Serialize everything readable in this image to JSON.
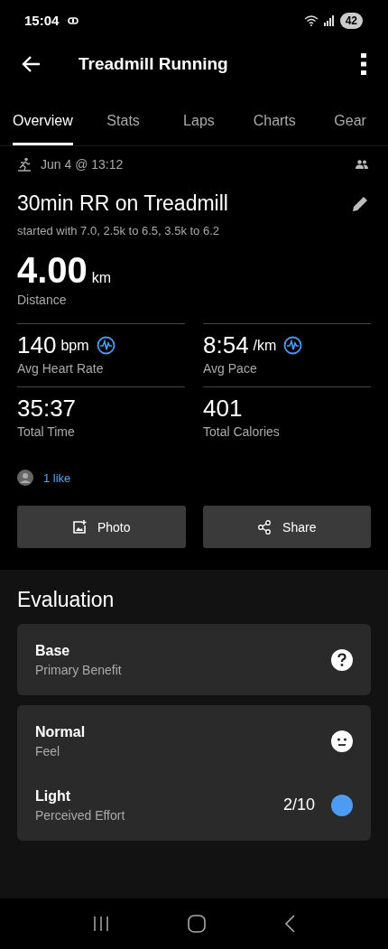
{
  "status_bar": {
    "time": "15:04",
    "battery": "42"
  },
  "app_bar": {
    "title": "Treadmill Running"
  },
  "tabs": [
    {
      "label": "Overview",
      "selected": true
    },
    {
      "label": "Stats",
      "selected": false
    },
    {
      "label": "Laps",
      "selected": false
    },
    {
      "label": "Charts",
      "selected": false
    },
    {
      "label": "Gear",
      "selected": false
    }
  ],
  "activity": {
    "date": "Jun 4 @ 13:12",
    "name": "30min RR on Treadmill",
    "description": "started with 7.0, 2.5k to 6.5, 3.5k to 6.2",
    "distance": {
      "value": "4.00",
      "unit": "km",
      "label": "Distance"
    }
  },
  "stats": [
    {
      "value": "140",
      "unit": "bpm",
      "label": "Avg Heart Rate",
      "chart_link": true
    },
    {
      "value": "8:54",
      "unit": "/km",
      "label": "Avg Pace",
      "chart_link": true
    },
    {
      "value": "35:37",
      "label": "Total Time",
      "chart_link": false
    },
    {
      "value": "401",
      "label": "Total Calories",
      "chart_link": false
    }
  ],
  "likes": "1 like",
  "actions": [
    {
      "label": "Photo",
      "kind": "photo"
    },
    {
      "label": "Share",
      "kind": "share"
    }
  ],
  "evaluation": {
    "title": "Evaluation",
    "cards": [
      {
        "rows": [
          {
            "kind": "help",
            "title": "Base",
            "subtitle": "Primary Benefit"
          }
        ]
      },
      {
        "rows": [
          {
            "kind": "face",
            "title": "Normal",
            "subtitle": "Feel"
          },
          {
            "kind": "dot",
            "title": "Light",
            "subtitle": "Perceived Effort",
            "reading": "2/10",
            "color": "#4c9cf4"
          }
        ]
      }
    ]
  }
}
